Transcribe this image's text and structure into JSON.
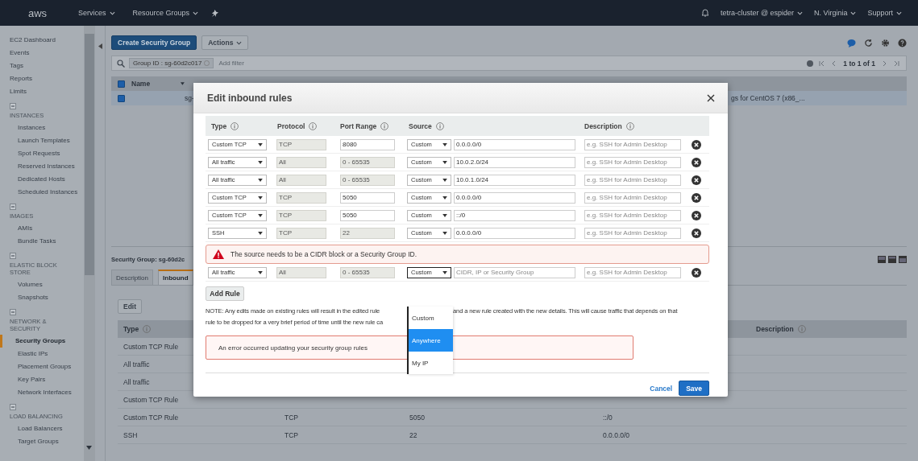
{
  "top_nav": {
    "logo": "aws",
    "menus": [
      "Services",
      "Resource Groups"
    ],
    "account": "tetra-cluster @ espider",
    "region": "N. Virginia",
    "support": "Support"
  },
  "sidebar": {
    "items": [
      {
        "label": "EC2 Dashboard",
        "selected": false
      },
      {
        "label": "Events",
        "selected": false
      },
      {
        "label": "Tags",
        "selected": false
      },
      {
        "label": "Reports",
        "selected": false
      },
      {
        "label": "Limits",
        "selected": false
      }
    ],
    "sections": [
      {
        "title": "INSTANCES",
        "items": [
          {
            "label": "Instances",
            "selected": false
          },
          {
            "label": "Launch Templates",
            "selected": false
          },
          {
            "label": "Spot Requests",
            "selected": false
          },
          {
            "label": "Reserved Instances",
            "selected": false
          },
          {
            "label": "Dedicated Hosts",
            "selected": false
          },
          {
            "label": "Scheduled Instances",
            "selected": false
          }
        ]
      },
      {
        "title": "IMAGES",
        "items": [
          {
            "label": "AMIs",
            "selected": false
          },
          {
            "label": "Bundle Tasks",
            "selected": false
          }
        ]
      },
      {
        "title": "ELASTIC BLOCK STORE",
        "items": [
          {
            "label": "Volumes",
            "selected": false
          },
          {
            "label": "Snapshots",
            "selected": false
          }
        ]
      },
      {
        "title": "NETWORK & SECURITY",
        "items": [
          {
            "label": "Security Groups",
            "selected": true
          },
          {
            "label": "Elastic IPs",
            "selected": false
          },
          {
            "label": "Placement Groups",
            "selected": false
          },
          {
            "label": "Key Pairs",
            "selected": false
          },
          {
            "label": "Network Interfaces",
            "selected": false
          }
        ]
      },
      {
        "title": "LOAD BALANCING",
        "items": [
          {
            "label": "Load Balancers",
            "selected": false
          },
          {
            "label": "Target Groups",
            "selected": false
          }
        ]
      }
    ]
  },
  "toolbar": {
    "buttons": [
      {
        "label": "Create Security Group",
        "kind": "primary"
      },
      {
        "label": "Actions",
        "kind": "menu"
      }
    ]
  },
  "filter": {
    "tokens": [
      "Group ID : sg-60d2c017"
    ],
    "placeholder": "Add filter",
    "pagination": "1 to 1 of 1"
  },
  "groups_table": {
    "all_selected": true,
    "columns": [
      "Name"
    ],
    "rows": [
      {
        "selected": true,
        "group_id": "sg-",
        "description": "gs for CentOS 7 (x86_..."
      }
    ]
  },
  "details": {
    "title": "Security Group: sg-60d2c",
    "tabs": [
      {
        "label": "Description",
        "selected": false
      },
      {
        "label": "Inbound",
        "selected": true
      }
    ],
    "edit_button": "Edit",
    "table": {
      "columns": [
        "Type",
        "Description"
      ],
      "rows": [
        {
          "type": "Custom TCP Rule"
        },
        {
          "type": "All traffic"
        },
        {
          "type": "All traffic"
        },
        {
          "type": "Custom TCP Rule"
        },
        {
          "type": "Custom TCP Rule",
          "protocol": "TCP",
          "port_range": "5050",
          "source": "::/0"
        },
        {
          "type": "SSH",
          "protocol": "TCP",
          "port_range": "22",
          "source": "0.0.0.0/0"
        }
      ]
    }
  },
  "modal": {
    "title": "Edit inbound rules",
    "columns": [
      "Type",
      "Protocol",
      "Port Range",
      "Source",
      "Description"
    ],
    "rules": [
      {
        "type": "Custom TCP",
        "protocol": "TCP",
        "port_range": "8080",
        "port_editable": true,
        "source_kind": "Custom",
        "source": "0.0.0.0/0",
        "description_placeholder": "e.g. SSH for Admin Desktop"
      },
      {
        "type": "All traffic",
        "protocol": "All",
        "port_range": "0 - 65535",
        "port_editable": false,
        "source_kind": "Custom",
        "source": "10.0.2.0/24",
        "description_placeholder": "e.g. SSH for Admin Desktop"
      },
      {
        "type": "All traffic",
        "protocol": "All",
        "port_range": "0 - 65535",
        "port_editable": false,
        "source_kind": "Custom",
        "source": "10.0.1.0/24",
        "description_placeholder": "e.g. SSH for Admin Desktop"
      },
      {
        "type": "Custom TCP",
        "protocol": "TCP",
        "port_range": "5050",
        "port_editable": true,
        "source_kind": "Custom",
        "source": "0.0.0.0/0",
        "description_placeholder": "e.g. SSH for Admin Desktop"
      },
      {
        "type": "Custom TCP",
        "protocol": "TCP",
        "port_range": "5050",
        "port_editable": true,
        "source_kind": "Custom",
        "source": "::/0",
        "description_placeholder": "e.g. SSH for Admin Desktop"
      },
      {
        "type": "SSH",
        "protocol": "TCP",
        "port_range": "22",
        "port_editable": false,
        "source_kind": "Custom",
        "source": "0.0.0.0/0",
        "description_placeholder": "e.g. SSH for Admin Desktop"
      }
    ],
    "error_banner": "The source needs to be a CIDR block or a Security Group ID.",
    "new_rule": {
      "type": "All traffic",
      "protocol": "All",
      "port_range": "0 - 65535",
      "port_editable": false,
      "source_kind": "Custom",
      "source_placeholder": "CIDR, IP or Security Group",
      "description_placeholder": "e.g. SSH for Admin Desktop",
      "source_menu": {
        "expanded": true,
        "options": [
          {
            "label": "Custom",
            "selected": false
          },
          {
            "label": "Anywhere",
            "selected": true
          },
          {
            "label": "My IP",
            "selected": false
          }
        ]
      }
    },
    "add_rule_button": "Add Rule",
    "note": [
      "NOTE: Any edits made on existing rules will result in the edited rule",
      "and a new rule created with the new details. This will cause traffic that depends on that",
      "rule to be dropped for a very brief period of time until the new rule ca"
    ],
    "error_message": "An error occurred updating your security group rules",
    "cancel": "Cancel",
    "save": "Save"
  }
}
